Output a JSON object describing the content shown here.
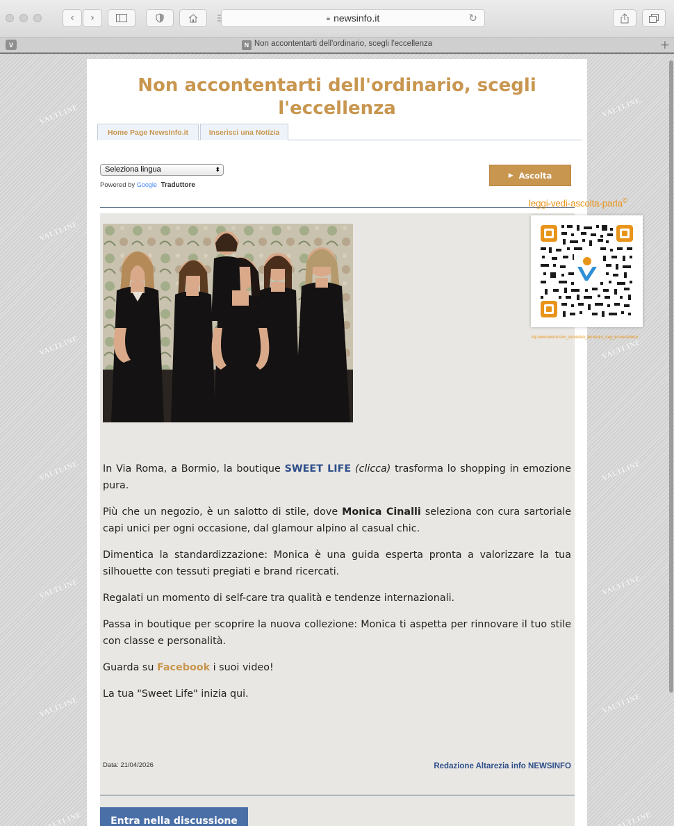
{
  "browser": {
    "url": "newsinfo.it",
    "tab_title": "Non accontentarti dell'ordinario, scegli l'eccellenza",
    "pinned_tab_letter": "V",
    "favicon_letter": "N"
  },
  "watermark": "VALTLINE",
  "page": {
    "headline": "Non accontentarti dell'ordinario, scegli l'eccellenza",
    "nav_tabs": [
      {
        "label": "Home Page NewsInfo.it"
      },
      {
        "label": "Inserisci una Notizia"
      }
    ],
    "language_select": {
      "value": "Seleziona lingua"
    },
    "powered_by": "Powered by",
    "google": "Google",
    "translator": "Traduttore",
    "listen_button": "Ascolta",
    "qr": {
      "label": "leggi-vedi-ascolta-parla",
      "copyright": "©",
      "url": "http://www.newsinfo.it/non_accontentarti_dellordinario_scegli_leccellenza/86825"
    },
    "article": {
      "p1": {
        "pre": "In Via Roma, a Bormio, la boutique ",
        "link": "SWEET LIFE",
        "italic": "(clicca)",
        "post": " trasforma lo shopping in emozione pura."
      },
      "p2": {
        "pre": "Più che un negozio, è un salotto di stile, dove ",
        "bold": "Monica Cinalli",
        "post": " seleziona con cura sartoriale capi unici per ogni occasione, dal glamour alpino al casual chic."
      },
      "p3": "Dimentica la standardizzazione: Monica è una guida esperta pronta a valorizzare la tua silhouette con tessuti pregiati e brand ricercati.",
      "p4": "Regalati un momento di self-care tra qualità e tendenze internazionali.",
      "p5": "Passa in boutique per scoprire la nuova collezione: Monica ti aspetta per rinnovare il tuo stile con classe e personalità.",
      "p6": {
        "pre": "Guarda su ",
        "link": "Facebook",
        "post": " i suoi video!"
      },
      "p7": "La tua \"Sweet Life\" inizia qui.",
      "date": "Data: 21/04/2026",
      "author": "Redazione Altarezia info NEWSINFO"
    },
    "discussion_button": "Entra nella discussione"
  },
  "colors": {
    "accent_gold": "#c8964f",
    "link_blue": "#2e4f8a",
    "qr_orange": "#e8941a",
    "button_blue": "#4a6fa7"
  }
}
